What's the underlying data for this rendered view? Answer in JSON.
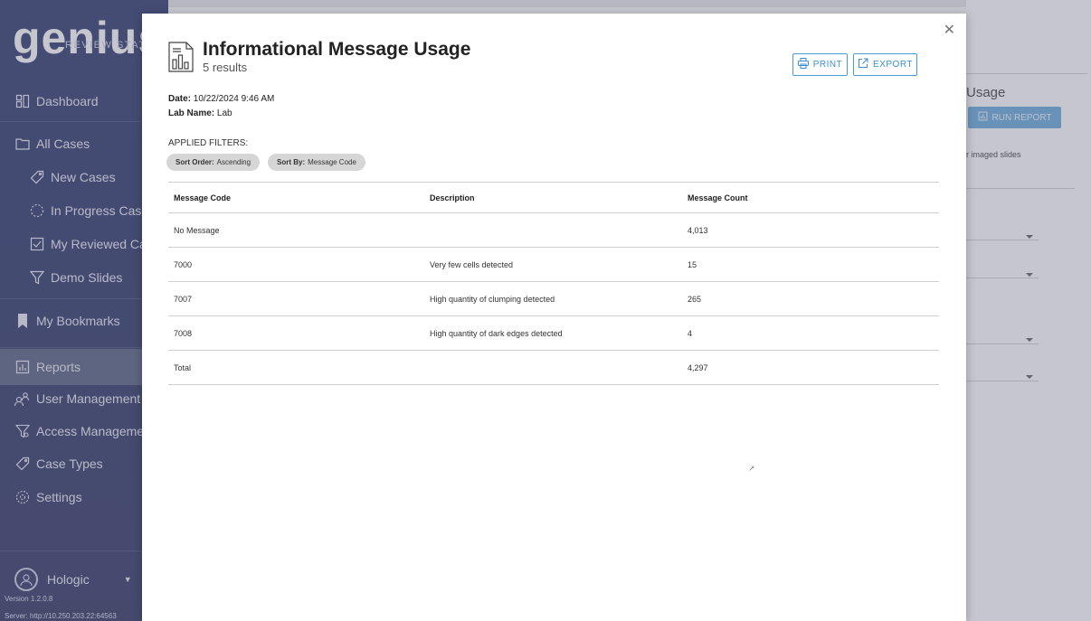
{
  "sidebar": {
    "logo_word": "genius",
    "logo_sub": "REVIEW STATIO",
    "items": [
      {
        "label": "Dashboard",
        "icon": "dashboard-icon"
      },
      {
        "label": "All Cases",
        "icon": "folder-icon"
      },
      {
        "label": "New Cases",
        "icon": "tag-icon"
      },
      {
        "label": "In Progress Cases",
        "icon": "progress-icon"
      },
      {
        "label": "My Reviewed Case",
        "icon": "checkbox-icon"
      },
      {
        "label": "Demo Slides",
        "icon": "filter-icon"
      },
      {
        "label": "My Bookmarks",
        "icon": "bookmark-icon"
      },
      {
        "label": "Reports",
        "icon": "report-icon"
      },
      {
        "label": "User Management",
        "icon": "users-icon"
      },
      {
        "label": "Access Management",
        "icon": "access-icon"
      },
      {
        "label": "Case Types",
        "icon": "tag-icon"
      },
      {
        "label": "Settings",
        "icon": "gear-icon"
      }
    ],
    "user": "Hologic",
    "version": "Version 1.2.0.8",
    "server": "Server: http://10.250.203.22:64563"
  },
  "background": {
    "title": "Usage",
    "run_report": "RUN REPORT",
    "note": "r imaged slides"
  },
  "modal": {
    "title": "Informational Message Usage",
    "subtitle": "5 results",
    "print_label": "PRINT",
    "export_label": "EXPORT",
    "date_label": "Date:",
    "date_value": "10/22/2024 9:46 AM",
    "lab_label": "Lab Name:",
    "lab_value": "Lab",
    "filters_label": "APPLIED FILTERS:",
    "chips": [
      {
        "key": "Sort Order:",
        "value": "Ascending"
      },
      {
        "key": "Sort By:",
        "value": "Message Code"
      }
    ],
    "columns": [
      "Message Code",
      "Description",
      "Message Count"
    ],
    "rows": [
      [
        "No Message",
        "",
        "4,013"
      ],
      [
        "7000",
        "Very few cells detected",
        "15"
      ],
      [
        "7007",
        "High quantity of clumping detected",
        "265"
      ],
      [
        "7008",
        "High quantity of dark edges detected",
        "4"
      ],
      [
        "Total",
        "",
        "4,297"
      ]
    ]
  },
  "colors": {
    "sidebar": "#1f2d63",
    "accent": "#3b8ecb",
    "active": "#4b5878"
  }
}
